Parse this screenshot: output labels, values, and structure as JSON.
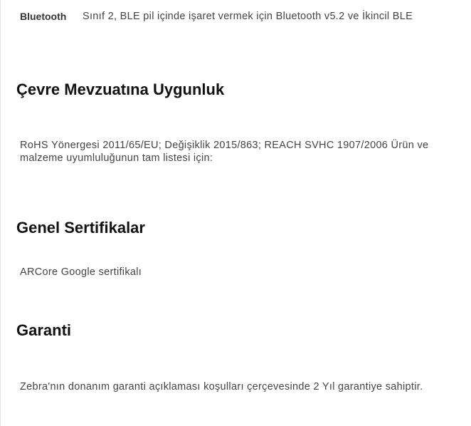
{
  "bluetooth": {
    "label": "Bluetooth",
    "value": "Sınıf 2, BLE pil içinde işaret vermek için Bluetooth v5.2 ve İkincil BLE"
  },
  "sections": [
    {
      "title": "Çevre Mevzuatına Uygunluk",
      "body": "RoHS Yönergesi 2011/65/EU; Değişiklik 2015/863; REACH SVHC 1907/2006 Ürün ve malzeme uyumluluğunun tam listesi için:"
    },
    {
      "title": "Genel Sertifikalar",
      "body": "ARCore Google sertifikalı"
    },
    {
      "title": "Garanti",
      "body": "Zebra'nın donanım garanti açıklaması koşulları çerçevesinde 2 Yıl garantiye sahiptir."
    }
  ]
}
